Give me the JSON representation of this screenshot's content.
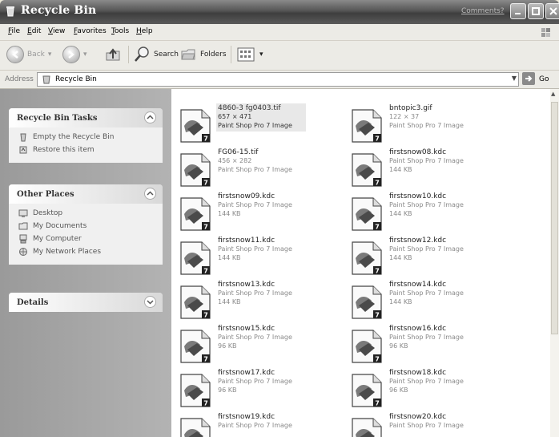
{
  "window": {
    "title": "Recycle Bin",
    "title_extra": "Comments?"
  },
  "menu": [
    "File",
    "Edit",
    "View",
    "Favorites",
    "Tools",
    "Help"
  ],
  "toolbar": {
    "back": "Back",
    "search": "Search",
    "folders": "Folders"
  },
  "address": {
    "label": "Address",
    "value": "Recycle Bin",
    "go": "Go"
  },
  "panels": {
    "tasks": {
      "title": "Recycle Bin Tasks",
      "items": [
        {
          "label": "Empty the Recycle Bin",
          "icon": "empty-bin-icon"
        },
        {
          "label": "Restore this item",
          "icon": "restore-icon"
        }
      ]
    },
    "places": {
      "title": "Other Places",
      "items": [
        {
          "label": "Desktop",
          "icon": "desktop-icon"
        },
        {
          "label": "My Documents",
          "icon": "my-documents-icon"
        },
        {
          "label": "My Computer",
          "icon": "my-computer-icon"
        },
        {
          "label": "My Network Places",
          "icon": "network-places-icon"
        }
      ]
    },
    "details": {
      "title": "Details"
    }
  },
  "files": [
    {
      "name": "4860-3 fg0403.tif",
      "meta1": "657 × 471",
      "meta2": "Paint Shop Pro 7 Image",
      "selected": true
    },
    {
      "name": "bntopic3.gif",
      "meta1": "122 × 37",
      "meta2": "Paint Shop Pro 7 Image"
    },
    {
      "name": "FG06-15.tif",
      "meta1": "456 × 282",
      "meta2": "Paint Shop Pro 7 Image"
    },
    {
      "name": "firstsnow08.kdc",
      "meta1": "Paint Shop Pro 7 Image",
      "meta2": "144 KB"
    },
    {
      "name": "firstsnow09.kdc",
      "meta1": "Paint Shop Pro 7 Image",
      "meta2": "144 KB"
    },
    {
      "name": "firstsnow10.kdc",
      "meta1": "Paint Shop Pro 7 Image",
      "meta2": "144 KB"
    },
    {
      "name": "firstsnow11.kdc",
      "meta1": "Paint Shop Pro 7 Image",
      "meta2": "144 KB"
    },
    {
      "name": "firstsnow12.kdc",
      "meta1": "Paint Shop Pro 7 Image",
      "meta2": "144 KB"
    },
    {
      "name": "firstsnow13.kdc",
      "meta1": "Paint Shop Pro 7 Image",
      "meta2": "144 KB"
    },
    {
      "name": "firstsnow14.kdc",
      "meta1": "Paint Shop Pro 7 Image",
      "meta2": "144 KB"
    },
    {
      "name": "firstsnow15.kdc",
      "meta1": "Paint Shop Pro 7 Image",
      "meta2": "96 KB"
    },
    {
      "name": "firstsnow16.kdc",
      "meta1": "Paint Shop Pro 7 Image",
      "meta2": "96 KB"
    },
    {
      "name": "firstsnow17.kdc",
      "meta1": "Paint Shop Pro 7 Image",
      "meta2": "96 KB"
    },
    {
      "name": "firstsnow18.kdc",
      "meta1": "Paint Shop Pro 7 Image",
      "meta2": "96 KB"
    },
    {
      "name": "firstsnow19.kdc",
      "meta1": "Paint Shop Pro 7 Image",
      "meta2": ""
    },
    {
      "name": "firstsnow20.kdc",
      "meta1": "Paint Shop Pro 7 Image",
      "meta2": ""
    }
  ]
}
